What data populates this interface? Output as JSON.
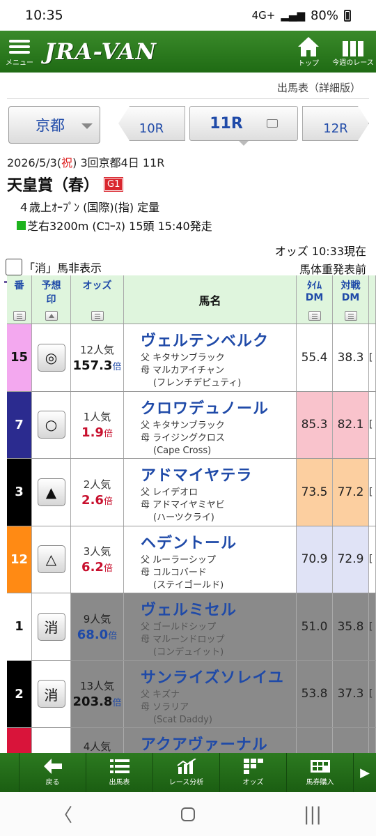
{
  "status": {
    "time": "10:35",
    "network": "4G+",
    "battery": "80%"
  },
  "header": {
    "menu_label": "メニュー",
    "logo": "JRA-VAN",
    "top_label": "トップ",
    "week_label": "今週のレース"
  },
  "subnav": {
    "page_label": "出馬表（詳細版）"
  },
  "race_nav": {
    "venue": "京都",
    "prev": "10R",
    "current": "11R",
    "next": "12R"
  },
  "race": {
    "date_pre": "2026/5/3(",
    "date_holiday": "祝",
    "date_post": ") 3回京都4日 11R",
    "title": "天皇賞（春）",
    "grade": "G1",
    "conditions": "４歳上ｵｰﾌﾟﾝ (国際)(指) 定量",
    "course": "芝右3200m (Cｺｰｽ) 15頭 15:40発走"
  },
  "odds_info": {
    "odds_time": "オッズ 10:33現在",
    "weight_note": "馬体重発表前",
    "hide_scratched": "「消」馬非表示"
  },
  "table": {
    "headers": {
      "num": "番",
      "mark_1": "予想",
      "mark_2": "印",
      "odds": "オッズ",
      "name": "馬名",
      "tdm_1": "ﾀｲﾑ",
      "tdm_2": "DM",
      "vdm_1": "対戦",
      "vdm_2": "DM"
    },
    "rows": [
      {
        "num": "15",
        "mark": "◎",
        "pop": "12人気",
        "odds": "157.3",
        "bai": "倍",
        "name": "ヴェルテンベルク",
        "sire": "父 キタサンブラック",
        "dam": "母 マルカアイチャン",
        "damsire": "(フレンチデピュティ)",
        "tdm": "55.4",
        "vdm": "38.3",
        "ext": "["
      },
      {
        "num": "7",
        "mark": "○",
        "pop": "1人気",
        "odds": "1.9",
        "bai": "倍",
        "name": "クロワデュノール",
        "sire": "父 キタサンブラック",
        "dam": "母 ライジングクロス",
        "damsire": "(Cape Cross)",
        "tdm": "85.3",
        "vdm": "82.1",
        "ext": "["
      },
      {
        "num": "3",
        "mark": "▲",
        "pop": "2人気",
        "odds": "2.6",
        "bai": "倍",
        "name": "アドマイヤテラ",
        "sire": "父 レイデオロ",
        "dam": "母 アドマイヤミヤビ",
        "damsire": "(ハーツクライ)",
        "tdm": "73.5",
        "vdm": "77.2",
        "ext": "["
      },
      {
        "num": "12",
        "mark": "△",
        "pop": "3人気",
        "odds": "6.2",
        "bai": "倍",
        "name": "ヘデントール",
        "sire": "父 ルーラーシップ",
        "dam": "母 コルコバード",
        "damsire": "(ステイゴールド)",
        "tdm": "70.9",
        "vdm": "72.9",
        "ext": "["
      },
      {
        "num": "1",
        "mark": "消",
        "pop": "9人気",
        "odds": "68.0",
        "bai": "倍",
        "name": "ヴェルミセル",
        "sire": "父 ゴールドシップ",
        "dam": "母 マルーンドロップ",
        "damsire": "(コンデュイット)",
        "tdm": "51.0",
        "vdm": "35.8",
        "ext": "["
      },
      {
        "num": "2",
        "mark": "消",
        "pop": "13人気",
        "odds": "203.8",
        "bai": "倍",
        "name": "サンライズソレイユ",
        "sire": "父 キズナ",
        "dam": "母 ソラリア",
        "damsire": "(Scat Daddy)",
        "tdm": "53.8",
        "vdm": "37.3",
        "ext": "["
      },
      {
        "num": "",
        "mark": "",
        "pop": "4人気",
        "odds": "",
        "bai": "",
        "name": "アクアヴァーナル",
        "sire": "",
        "dam": "",
        "damsire": "",
        "tdm": "",
        "vdm": "",
        "ext": ""
      }
    ]
  },
  "bottom_nav": {
    "back": "戻る",
    "card": "出馬表",
    "analysis": "レース分析",
    "odds": "オッズ",
    "betting": "馬券購入"
  },
  "colors": {
    "brand_green": "#1f6b14",
    "link_blue": "#1f4aa8",
    "holiday_red": "#d22222",
    "grade_red": "#d9262e",
    "header_green": "#dff5dd"
  }
}
